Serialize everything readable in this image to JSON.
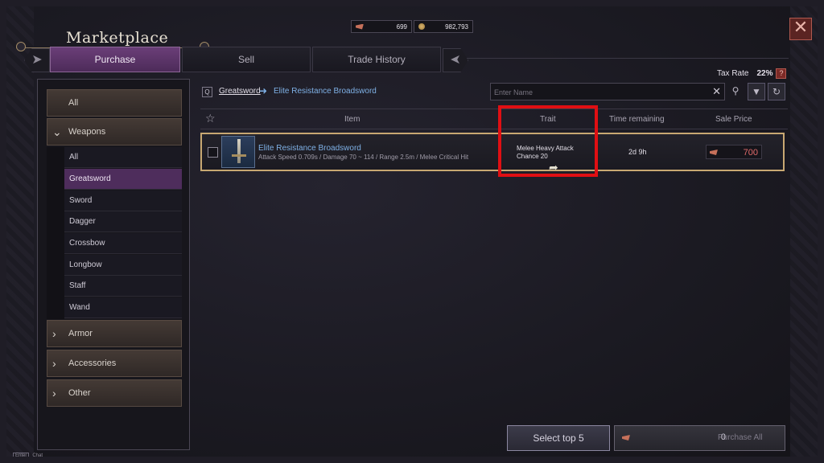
{
  "window": {
    "title": "Marketplace",
    "close_glyph": "✕"
  },
  "currency": {
    "lucent": "699",
    "silver": "982,793",
    "lucent_icon": "lucent-icon",
    "silver_icon": "silver-coin-icon"
  },
  "tabs": [
    {
      "label": "Purchase",
      "active": true
    },
    {
      "label": "Sell",
      "active": false
    },
    {
      "label": "Trade History",
      "active": false
    }
  ],
  "tax": {
    "label": "Tax Rate",
    "rate": "22%",
    "help": "?"
  },
  "sidebar": {
    "all_label": "All",
    "weapons": {
      "label": "Weapons",
      "items": [
        {
          "label": "All"
        },
        {
          "label": "Greatsword",
          "active": true
        },
        {
          "label": "Sword"
        },
        {
          "label": "Dagger"
        },
        {
          "label": "Crossbow"
        },
        {
          "label": "Longbow"
        },
        {
          "label": "Staff"
        },
        {
          "label": "Wand"
        }
      ]
    },
    "armor": "Armor",
    "accessories": "Accessories",
    "other": "Other"
  },
  "breadcrumb": {
    "q_key": "Q",
    "parent": "Greatsword",
    "arrow": "➜",
    "current": "Elite Resistance Broadsword"
  },
  "search": {
    "placeholder": "Enter Name",
    "value": ""
  },
  "table": {
    "headers": {
      "item": "Item",
      "trait": "Trait",
      "time": "Time remaining",
      "price": "Sale Price"
    },
    "rows": [
      {
        "name": "Elite Resistance Broadsword",
        "stats": "Attack Speed 0.709s / Damage 70 ~ 114 / Range 2.5m / Melee Critical Hit",
        "trait_line1": "Melee Heavy Attack",
        "trait_line2": "Chance 20",
        "time": "2d 9h",
        "price": "700"
      }
    ]
  },
  "buttons": {
    "select_top": "Select top 5",
    "purchase_count": "0",
    "purchase_all": "Purchase All"
  },
  "hint": {
    "key": "Enter",
    "label": "Chat"
  },
  "colors": {
    "accent_purple": "#6a3e78",
    "highlight_red": "#e00f13",
    "link_blue": "#7fb1e6",
    "price_red": "#e06a6a",
    "row_border_gold": "#c8a872"
  }
}
